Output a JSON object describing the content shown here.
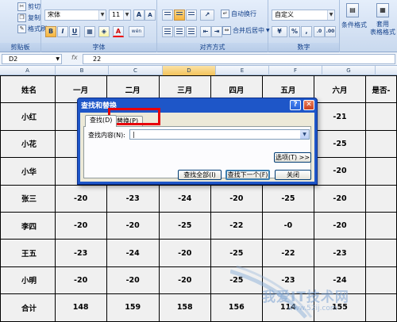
{
  "ribbon": {
    "clipboard": {
      "cut": "剪切",
      "copy": "复制",
      "format_painter": "格式刷",
      "group_label": "剪贴板"
    },
    "font": {
      "font_name": "宋体",
      "font_size": "11",
      "grow": "A",
      "shrink": "A",
      "bold": "B",
      "italic": "I",
      "underline": "U",
      "font_color": "A",
      "phonetic": "wén",
      "group_label": "字体"
    },
    "alignment": {
      "wrap_text": "自动换行",
      "merge_center": "合并后居中",
      "group_label": "对齐方式"
    },
    "number": {
      "format": "自定义",
      "percent": "%",
      "comma": ",",
      "group_label": "数字"
    },
    "styles": {
      "conditional": "条件格式",
      "table_style": "套用\n表格格式"
    }
  },
  "formula_bar": {
    "name_box": "D2",
    "fx": "fx",
    "content": "22"
  },
  "columns": [
    "A",
    "B",
    "C",
    "D",
    "E",
    "F",
    "G"
  ],
  "selected_column": "D",
  "table": {
    "headers": [
      "姓名",
      "一月",
      "二月",
      "三月",
      "四月",
      "五月",
      "六月",
      "是否-"
    ],
    "rows": [
      [
        "小红",
        "",
        "",
        "",
        "",
        "",
        "-21",
        ""
      ],
      [
        "小花",
        "",
        "",
        "",
        "",
        "",
        "-25",
        ""
      ],
      [
        "小华",
        "",
        "",
        "",
        "",
        "",
        "-20",
        ""
      ],
      [
        "张三",
        "-20",
        "-23",
        "-24",
        "-20",
        "-25",
        "-20",
        ""
      ],
      [
        "李四",
        "-20",
        "-20",
        "-25",
        "-22",
        "-0",
        "-20",
        ""
      ],
      [
        "王五",
        "-23",
        "-24",
        "-20",
        "-25",
        "-22",
        "-23",
        ""
      ],
      [
        "小明",
        "-20",
        "-20",
        "-20",
        "-25",
        "-23",
        "-24",
        ""
      ],
      [
        "合计",
        "148",
        "159",
        "158",
        "156",
        "114",
        "155",
        ""
      ]
    ]
  },
  "dialog": {
    "title": "查找和替换",
    "help": "?",
    "close": "✕",
    "tab_find": "查找(D)",
    "tab_replace": "替换(P)",
    "find_label": "查找内容(N):",
    "find_value": "|",
    "options_button": "选项(T) >>",
    "find_all_button": "查找全部(I)",
    "find_next_button": "查找下一个(F)",
    "close_button": "关闭"
  },
  "watermark": {
    "main": "我爱IT技术网",
    "sub": "www.52ij.com"
  }
}
